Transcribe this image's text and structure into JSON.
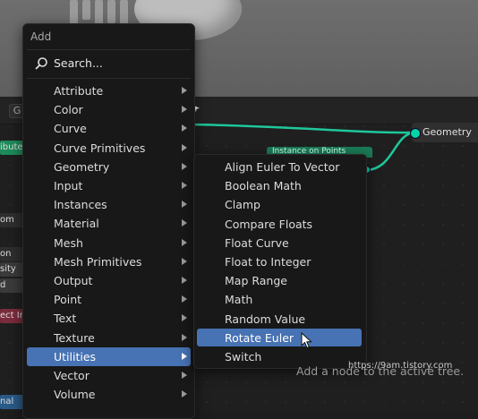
{
  "header": {
    "editor_button": "G"
  },
  "left_strips": [
    {
      "text": "ibute",
      "color": "#1d8a5a"
    },
    {
      "text": "om",
      "color": "#2e2e2e"
    },
    {
      "text": "on",
      "color": "#2e2e2e"
    },
    {
      "text": "sity",
      "color": "#3a3a3a"
    },
    {
      "text": "d",
      "color": "#3a3a3a"
    },
    {
      "text": "ect In",
      "color": "#7a2b3c"
    },
    {
      "text": "nal",
      "color": "#2a5a88"
    }
  ],
  "nodes": {
    "group_output": {
      "socket_label": "Geometry"
    },
    "instance_on_points": {
      "title": "Instance on Points"
    }
  },
  "add_menu": {
    "title": "Add",
    "search_label": "Search...",
    "items": [
      {
        "label": "Attribute",
        "has_submenu": true
      },
      {
        "label": "Color",
        "has_submenu": true
      },
      {
        "label": "Curve",
        "has_submenu": true
      },
      {
        "label": "Curve Primitives",
        "has_submenu": true
      },
      {
        "label": "Geometry",
        "has_submenu": true
      },
      {
        "label": "Input",
        "has_submenu": true
      },
      {
        "label": "Instances",
        "has_submenu": true
      },
      {
        "label": "Material",
        "has_submenu": true
      },
      {
        "label": "Mesh",
        "has_submenu": true
      },
      {
        "label": "Mesh Primitives",
        "has_submenu": true
      },
      {
        "label": "Output",
        "has_submenu": true
      },
      {
        "label": "Point",
        "has_submenu": true
      },
      {
        "label": "Text",
        "has_submenu": true
      },
      {
        "label": "Texture",
        "has_submenu": true
      },
      {
        "label": "Utilities",
        "has_submenu": true,
        "active": true
      },
      {
        "label": "Vector",
        "has_submenu": true
      },
      {
        "label": "Volume",
        "has_submenu": true
      }
    ]
  },
  "utilities_submenu": {
    "items": [
      {
        "label": "Align Euler To Vector"
      },
      {
        "label": "Boolean Math"
      },
      {
        "label": "Clamp"
      },
      {
        "label": "Compare Floats"
      },
      {
        "label": "Float Curve"
      },
      {
        "label": "Float to Integer"
      },
      {
        "label": "Map Range"
      },
      {
        "label": "Math"
      },
      {
        "label": "Random Value"
      },
      {
        "label": "Rotate Euler",
        "active": true
      },
      {
        "label": "Switch"
      }
    ]
  },
  "status_hint": "Add a node to the active tree.",
  "watermark": "https://9am.tistory.com",
  "colors": {
    "accent": "#4772b3",
    "socket_geometry": "#00d6a3",
    "menu_bg": "#181818"
  }
}
